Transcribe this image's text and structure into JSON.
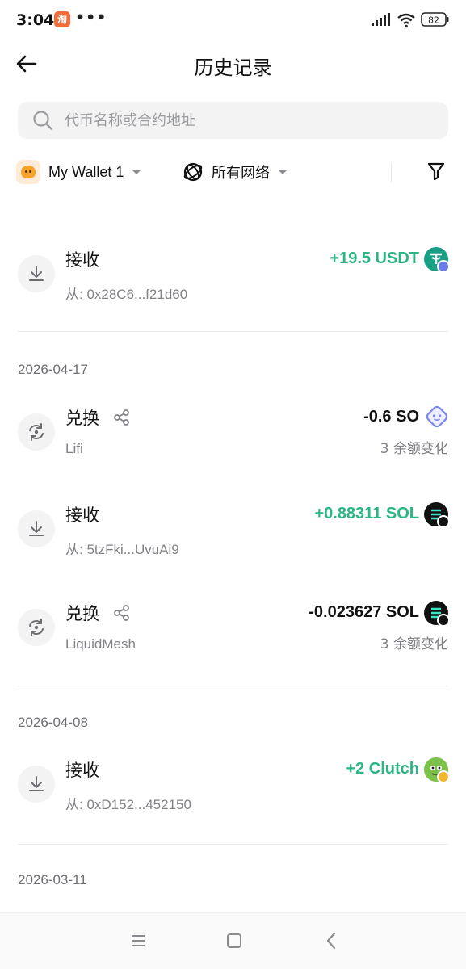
{
  "status_bar": {
    "time": "3:04",
    "app_badge": "淘",
    "dots": "•••",
    "battery": "82"
  },
  "header": {
    "title": "历史记录"
  },
  "search": {
    "placeholder": "代币名称或合约地址"
  },
  "filters": {
    "wallet": "My Wallet 1",
    "network": "所有网络"
  },
  "transactions": [
    {
      "type": "接收",
      "sub": "从: 0x28C6...f21d60",
      "amount": "+19.5 USDT",
      "sign": "pos",
      "token_icon": "usdt-eth-icon"
    },
    {
      "type": "兑换",
      "sub": "Lifi",
      "amount": "-0.6 SO",
      "sign": "neg",
      "change": "3 余额变化",
      "token_icon": "so-token-icon"
    },
    {
      "type": "接收",
      "sub": "从: 5tzFki...UvuAi9",
      "amount": "+0.88311 SOL",
      "sign": "pos",
      "token_icon": "sol-icon"
    },
    {
      "type": "兑换",
      "sub": "LiquidMesh",
      "amount": "-0.023627 SOL",
      "sign": "neg",
      "change": "3 余额变化",
      "token_icon": "sol-icon"
    },
    {
      "type": "接收",
      "sub": "从: 0xD152...452150",
      "amount": "+2 Clutch",
      "sign": "pos",
      "token_icon": "clutch-token-icon"
    }
  ],
  "dates": [
    "2026-04-17",
    "2026-04-08",
    "2026-03-11"
  ],
  "colors": {
    "positive": "#2ab683",
    "negative": "#111111",
    "muted": "#808186"
  }
}
